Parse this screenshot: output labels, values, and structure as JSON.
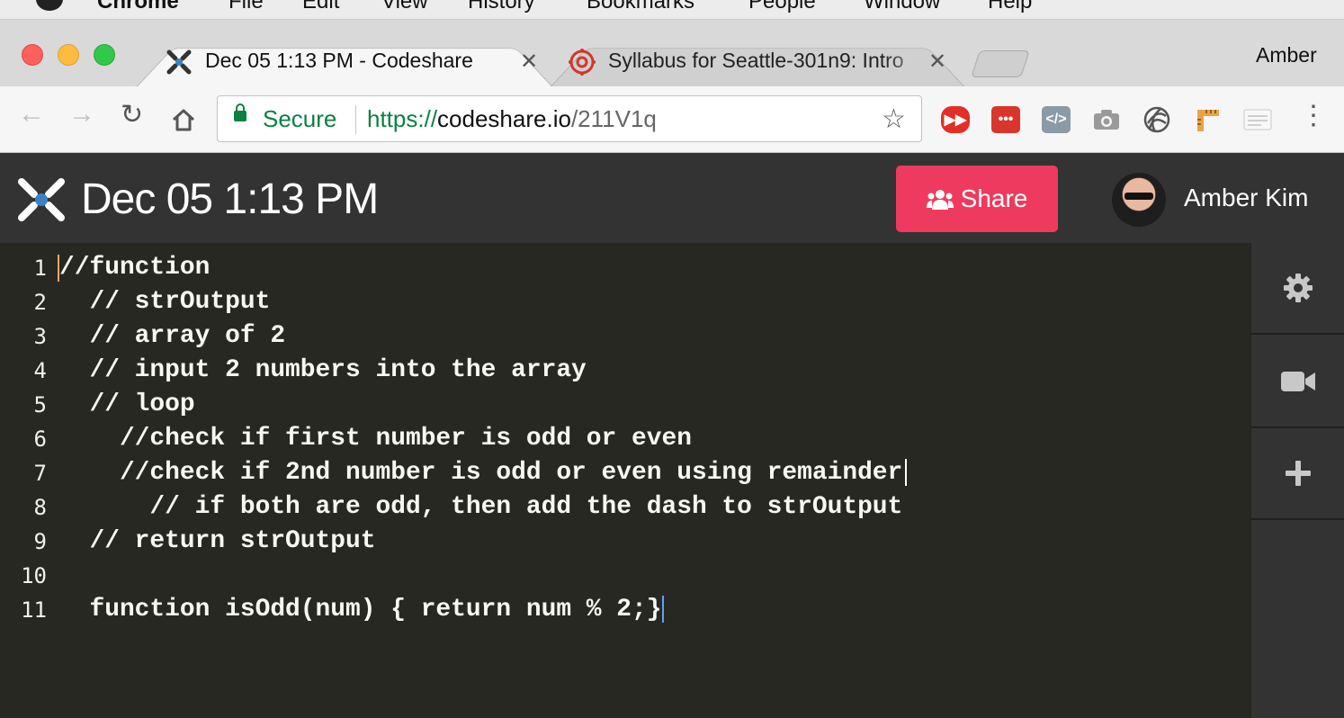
{
  "menubar": {
    "items": [
      "Chrome",
      "File",
      "Edit",
      "View",
      "History",
      "Bookmarks",
      "People",
      "Window",
      "Help"
    ]
  },
  "browser": {
    "tabs": [
      {
        "title": "Dec 05 1:13 PM - Codeshare",
        "active": true
      },
      {
        "title": "Syllabus for Seattle-301n9: Intro",
        "active": false
      }
    ],
    "profile_name": "Amber",
    "omnibox": {
      "security_label": "Secure",
      "url_scheme": "https://",
      "url_host": "codeshare.io",
      "url_path": "/211V1q"
    },
    "extensions": [
      "youtube-ext-icon",
      "more-ext-icon",
      "code-ext-icon",
      "camera-ext-icon",
      "spiral-ext-icon",
      "ruler-ext-icon",
      "notes-ext-icon"
    ]
  },
  "app": {
    "title": "Dec 05 1:13 PM",
    "share_label": "Share",
    "user_name": "Amber Kim",
    "accent": "#ee3a5f"
  },
  "editor": {
    "line_numbers": [
      "1",
      "2",
      "3",
      "4",
      "5",
      "6",
      "7",
      "8",
      "9",
      "10",
      "11"
    ],
    "lines": [
      "//function",
      "  // strOutput",
      "  // array of 2",
      "  // input 2 numbers into the array",
      "  // loop",
      "    //check if first number is odd or even",
      "    //check if 2nd number is odd or even using remainder",
      "      // if both are odd, then add the dash to strOutput",
      "  // return strOutput",
      "",
      "  function isOdd(num) { return num % 2;}"
    ]
  },
  "sidebar": {
    "buttons": [
      "settings-icon",
      "video-icon",
      "plus-icon"
    ]
  }
}
